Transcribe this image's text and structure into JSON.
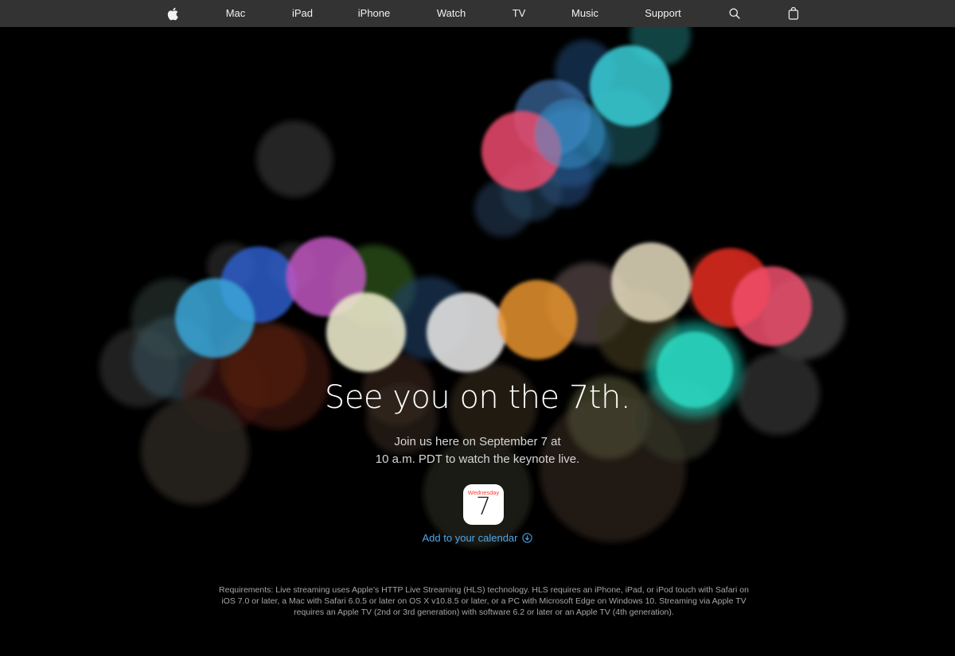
{
  "nav": {
    "items": [
      {
        "label": "Mac"
      },
      {
        "label": "iPad"
      },
      {
        "label": "iPhone"
      },
      {
        "label": "Watch"
      },
      {
        "label": "TV"
      },
      {
        "label": "Music"
      },
      {
        "label": "Support"
      }
    ],
    "icons": {
      "logo": "apple-logo-icon",
      "search": "search-icon",
      "bag": "shopping-bag-icon"
    }
  },
  "hero": {
    "headline": "See you on the 7th.",
    "subhead_line1": "Join us here on September 7 at",
    "subhead_line2": "10 a.m. PDT to watch the keynote live.",
    "calendar_day": "Wednesday",
    "calendar_date": "7",
    "calendar_link": "Add to your calendar"
  },
  "footer": {
    "requirements": "Requirements: Live streaming uses Apple’s HTTP Live Streaming (HLS) technology. HLS requires an iPhone, iPad, or iPod touch with Safari on iOS 7.0 or later, a Mac with Safari 6.0.5 or later on OS X v10.8.5 or later, or a PC with Microsoft Edge on Windows 10. Streaming via Apple TV requires an Apple TV (2nd or 3rd generation) with software 6.2 or later or an Apple TV (4th generation)."
  },
  "colors": {
    "nav_background": "#333333",
    "page_background": "#000000",
    "link": "#4fa8e8",
    "calendar_day": "#ff3b30"
  }
}
